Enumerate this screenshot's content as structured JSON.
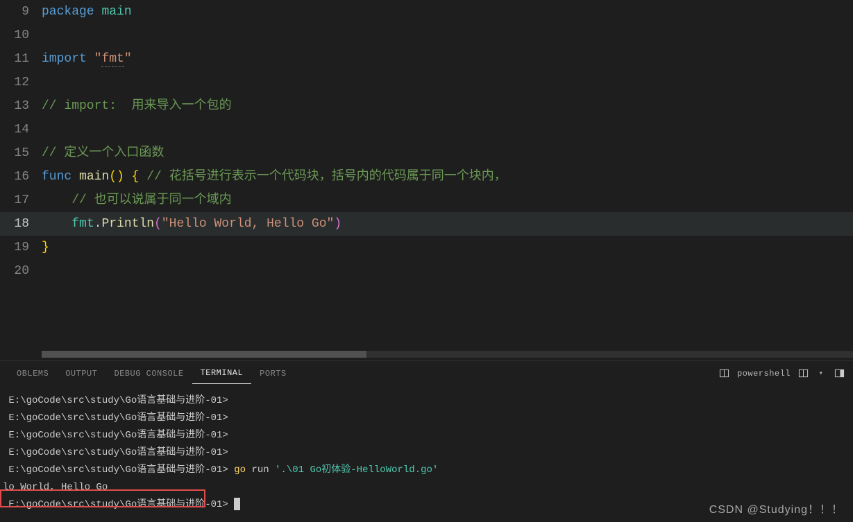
{
  "editor": {
    "lines": [
      {
        "n": 9,
        "tokens": [
          {
            "t": "package",
            "c": "kw"
          },
          {
            "t": " ",
            "c": ""
          },
          {
            "t": "main",
            "c": "pkg"
          }
        ]
      },
      {
        "n": 10,
        "tokens": []
      },
      {
        "n": 11,
        "tokens": [
          {
            "t": "import",
            "c": "kw"
          },
          {
            "t": " ",
            "c": ""
          },
          {
            "t": "\"",
            "c": "str"
          },
          {
            "t": "fmt",
            "c": "str underline"
          },
          {
            "t": "\"",
            "c": "str"
          }
        ]
      },
      {
        "n": 12,
        "tokens": []
      },
      {
        "n": 13,
        "tokens": [
          {
            "t": "// import:  用来导入一个包的",
            "c": "cmt"
          }
        ]
      },
      {
        "n": 14,
        "tokens": []
      },
      {
        "n": 15,
        "tokens": [
          {
            "t": "// 定义一个入口函数",
            "c": "cmt"
          }
        ]
      },
      {
        "n": 16,
        "tokens": [
          {
            "t": "func",
            "c": "kw"
          },
          {
            "t": " ",
            "c": ""
          },
          {
            "t": "main",
            "c": "fn"
          },
          {
            "t": "()",
            "c": "yellow"
          },
          {
            "t": " ",
            "c": ""
          },
          {
            "t": "{",
            "c": "yellow"
          },
          {
            "t": " ",
            "c": ""
          },
          {
            "t": "// 花括号进行表示一个代码块，括号内的代码属于同一个块内，",
            "c": "cmt"
          }
        ]
      },
      {
        "n": 17,
        "tokens": [
          {
            "t": "    ",
            "c": ""
          },
          {
            "t": "// 也可以说属于同一个域内",
            "c": "cmt"
          }
        ],
        "indent": 1
      },
      {
        "n": 18,
        "active": true,
        "tokens": [
          {
            "t": "    ",
            "c": ""
          },
          {
            "t": "fmt",
            "c": "pkg"
          },
          {
            "t": ".",
            "c": "punc"
          },
          {
            "t": "Println",
            "c": "fn"
          },
          {
            "t": "(",
            "c": "pink"
          },
          {
            "t": "\"Hello World, Hello Go\"",
            "c": "str"
          },
          {
            "t": ")",
            "c": "pink"
          }
        ],
        "indent": 1
      },
      {
        "n": 19,
        "tokens": [
          {
            "t": "}",
            "c": "yellow"
          }
        ]
      },
      {
        "n": 20,
        "tokens": []
      }
    ]
  },
  "panel": {
    "tabs": {
      "problems": "OBLEMS",
      "output": "OUTPUT",
      "debug": "DEBUG CONSOLE",
      "terminal": "TERMINAL",
      "ports": "PORTS"
    },
    "shell_label": "powershell"
  },
  "terminal": {
    "prompt": "E:\\goCode\\src\\study\\Go语言基础与进阶-01>",
    "cmd_prefix": "go",
    "cmd_rest": " run ",
    "cmd_arg": "'.\\01 Go初体验-HelloWorld.go'",
    "output_line": "lo World, Hello Go",
    "last_prompt_partial": "E:\\goCode\\src\\study\\Go语言基础与进阶-01>"
  },
  "watermark": "CSDN @Studying！！！"
}
